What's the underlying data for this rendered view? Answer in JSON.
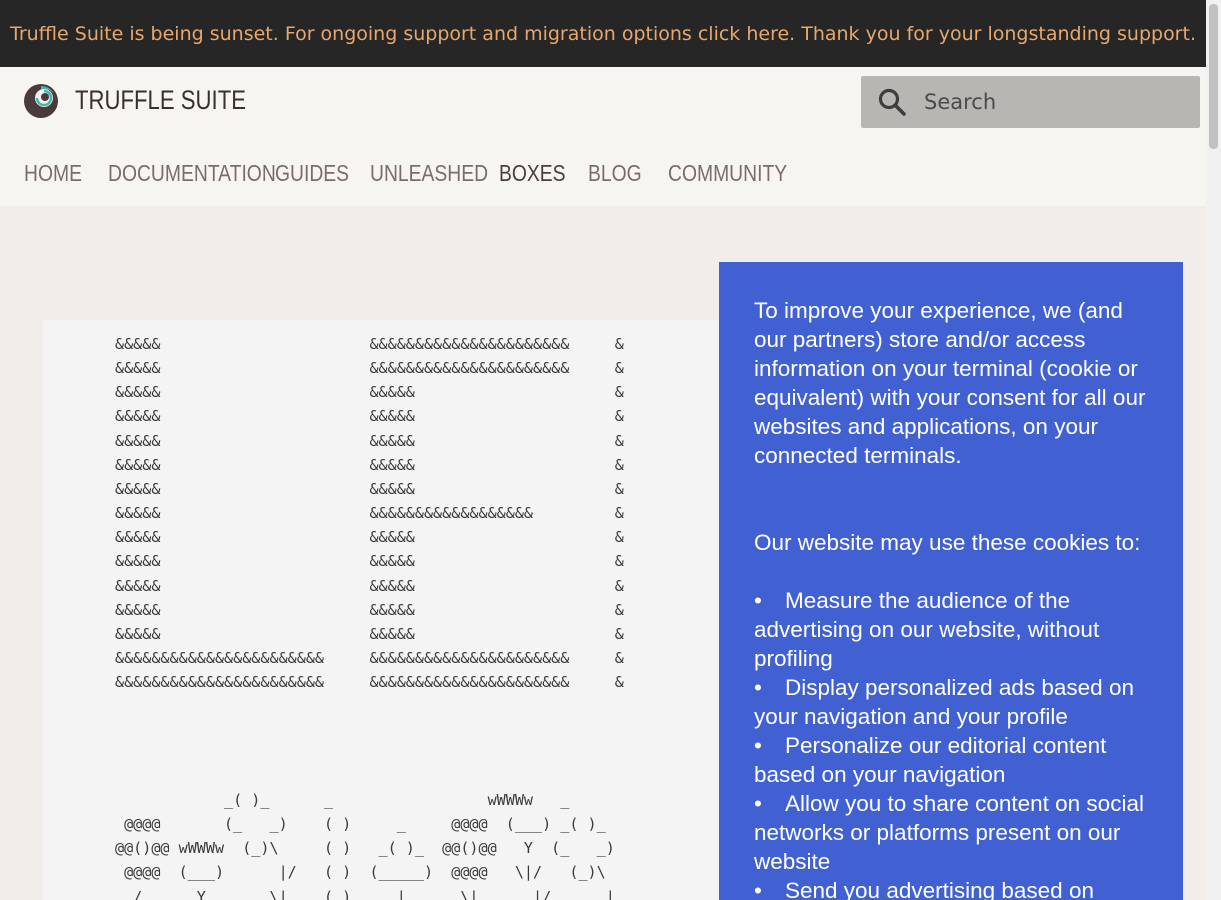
{
  "banner": {
    "text": "Truffle Suite is being sunset. For ongoing support and migration options click here. Thank you for your longstanding support."
  },
  "header": {
    "brand": "TRUFFLE SUITE",
    "logo_icon": "truffle-logo-icon",
    "search": {
      "placeholder": "Search",
      "value": "",
      "icon": "search-icon"
    }
  },
  "nav": {
    "items": [
      {
        "label": "HOME"
      },
      {
        "label": "DOCUMENTATION"
      },
      {
        "label": "GUIDES"
      },
      {
        "label": "UNLEASHED"
      },
      {
        "label": "BOXES"
      },
      {
        "label": "BLOG"
      },
      {
        "label": "COMMUNITY"
      }
    ],
    "active": "BOXES"
  },
  "code": {
    "ascii_text": "&&&&&                       &&&&&&&&&&&&&&&&&&&&&&     &\n&&&&&                       &&&&&&&&&&&&&&&&&&&&&&     &\n&&&&&                       &&&&&                      &\n&&&&&                       &&&&&                      &\n&&&&&                       &&&&&                      &\n&&&&&                       &&&&&                      &\n&&&&&                       &&&&&                      &\n&&&&&                       &&&&&&&&&&&&&&&&&&         &\n&&&&&                       &&&&&                      &\n&&&&&                       &&&&&                      &\n&&&&&                       &&&&&                      &\n&&&&&                       &&&&&                      &\n&&&&&                       &&&&&                      &\n&&&&&&&&&&&&&&&&&&&&&&&     &&&&&&&&&&&&&&&&&&&&&&     &\n&&&&&&&&&&&&&&&&&&&&&&&     &&&&&&&&&&&&&&&&&&&&&&     &",
    "art_text": "            _( )_      _                 wWWWw   _\n @@@@       (_   _)    ( )     _     @@@@  (___) _( )_\n@@()@@ wWWWw  (_)\\     ( )   _( )_  @@()@@   Y  (_   _)\n @@@@  (___)      |/   ( )  (_____)  @@@@   \\|/   (_)\\\n  /      Y       \\|    ( )     |      \\|      |/      |"
  },
  "cookie": {
    "intro": "To improve your experience, we (and our partners) store and/or access information on your terminal (cookie or equivalent) with your consent for all our websites and applications, on your connected terminals.",
    "uses_title": "Our website may use these cookies to:",
    "bullet": "•",
    "items": [
      "Measure the audience of the advertising on our website, without profiling",
      "Display personalized ads based on your navigation and your profile",
      "Personalize our editorial content based on your navigation",
      "Allow you to share content on social networks or platforms present on our website",
      "Send you advertising based on"
    ]
  },
  "colors": {
    "banner_bg": "#262626",
    "banner_text": "#e6a86e",
    "cookie_bg": "#4161d3",
    "nav_text": "#7b6b6b"
  }
}
